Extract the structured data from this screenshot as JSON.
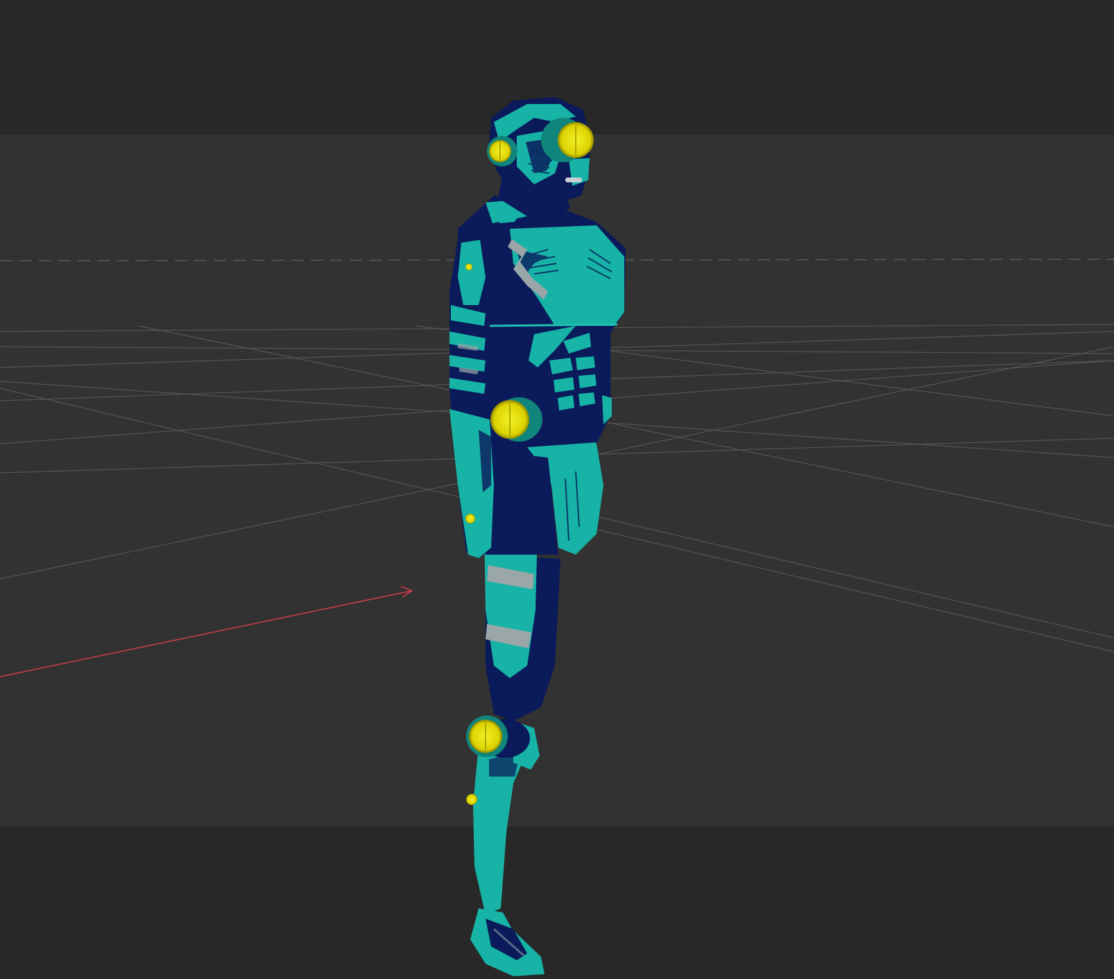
{
  "viewport": {
    "background_outer": "#282828",
    "background_band": "#323232",
    "grid_color": "#555555",
    "horizon_dash_color": "#5a5a5a",
    "x_axis_color": "#d0404a"
  },
  "model": {
    "suit_teal": "#17b3a6",
    "suit_teal_light": "#2bd0c0",
    "suit_navy": "#0a1a5a",
    "suit_navy_dark": "#071244",
    "accent_yellow": "#e6e000",
    "accent_yellow_dark": "#a8a000",
    "stripe_gray": "#9aa6a8"
  }
}
